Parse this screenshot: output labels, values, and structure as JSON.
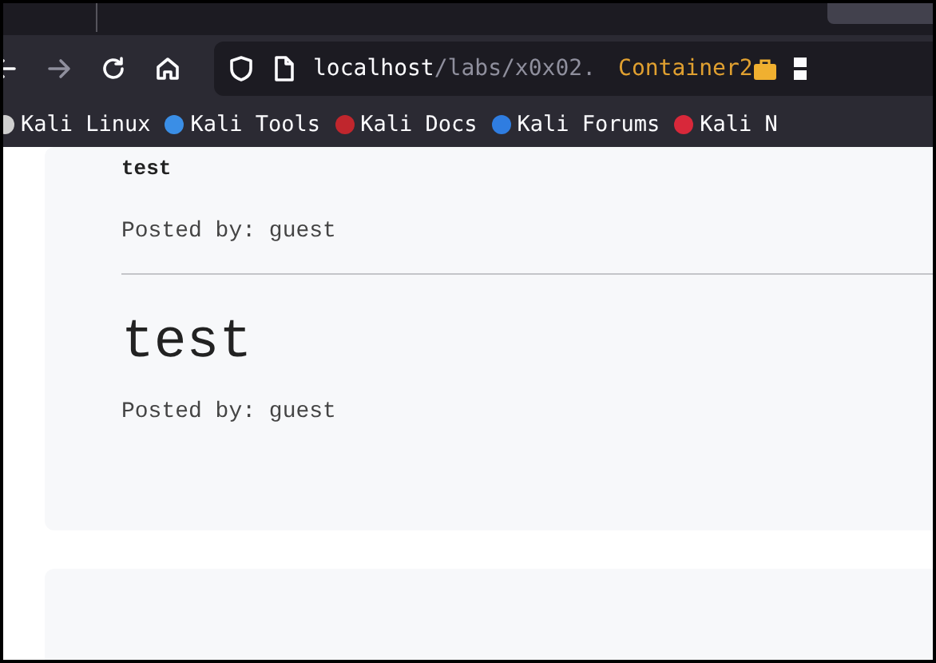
{
  "browser": {
    "url_host": "localhost",
    "url_path": "/labs/x0x02.",
    "container": "Container2",
    "bookmarks": [
      {
        "label": "Kali Linux",
        "color": "#cfcfcf"
      },
      {
        "label": "Kali Tools",
        "color": "#3a8ee6"
      },
      {
        "label": "Kali Docs",
        "color": "#c0262d"
      },
      {
        "label": "Kali Forums",
        "color": "#2f7de1"
      },
      {
        "label": "Kali N",
        "color": "#d8283a"
      }
    ]
  },
  "posts": [
    {
      "title": "test",
      "kind": "small",
      "author": "Posted by: guest"
    },
    {
      "title": "test",
      "kind": "large",
      "author": "Posted by: guest"
    }
  ]
}
